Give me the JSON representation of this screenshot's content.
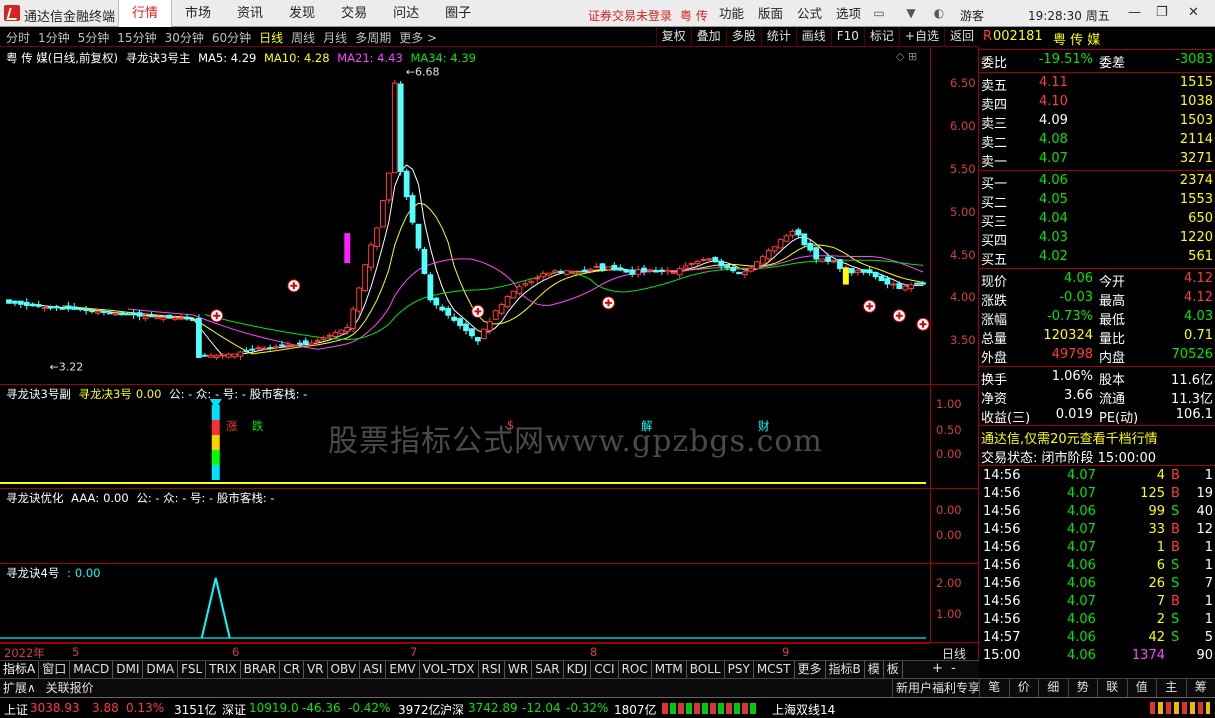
{
  "titlebar": {
    "app_name": "通达信金融终端",
    "menus": [
      "行情",
      "市场",
      "资讯",
      "发现",
      "交易",
      "问达",
      "圈子"
    ],
    "active_menu": "行情",
    "warning": "证券交易未登录",
    "stock_short": "粤 传",
    "right_menus": [
      "功能",
      "版面",
      "公式",
      "选项"
    ],
    "user": "游客",
    "clock": "19:28:30 周五"
  },
  "toolbar": {
    "periods": [
      "分时",
      "1分钟",
      "5分钟",
      "15分钟",
      "30分钟",
      "60分钟",
      "日线",
      "周线",
      "月线",
      "多周期",
      "更多 >"
    ],
    "selected_period": "日线",
    "tools": [
      "复权",
      "叠加",
      "多股",
      "统计",
      "画线",
      "F10",
      "标记",
      "+自选",
      "返回"
    ]
  },
  "main_panel": {
    "title": "粤 传 媒(日线,前复权)",
    "indicator": "寻龙诀3号主",
    "ma5": "MA5: 4.29",
    "ma10": "MA10: 4.28",
    "ma21": "MA21: 4.43",
    "ma34": "MA34: 4.39",
    "high_label": "6.68",
    "low_label": "3.22",
    "y_ticks": [
      "6.50",
      "6.00",
      "5.50",
      "5.00",
      "4.50",
      "4.00",
      "3.50"
    ],
    "events": [
      "涨",
      "跌",
      "$",
      "解",
      "财"
    ]
  },
  "sub1": {
    "name": "寻龙诀3号副",
    "key": "寻龙决3号",
    "val": "0.00",
    "tail": "公: - 众: - 号: - 股市客栈: -",
    "y_ticks": [
      "1.00",
      "0.50",
      "0.00"
    ]
  },
  "sub2": {
    "name": "寻龙诀优化",
    "key": "AAA:",
    "val": "0.00",
    "tail": "公: - 众: - 号: - 股市客栈: -",
    "y_ticks": [
      "0.00",
      "0.00"
    ]
  },
  "sub3": {
    "name": "寻龙诀4号",
    "key": ":",
    "val": "0.00",
    "y_ticks": [
      "2.00",
      "1.00"
    ]
  },
  "watermark": "股票指标公式网www.gpzbgs.com",
  "x_axis": {
    "labels": [
      "2022年",
      "5",
      "6",
      "7",
      "8",
      "9"
    ],
    "period": "日线"
  },
  "chart_data": {
    "type": "candlestick",
    "ma_series": [
      {
        "name": "MA5",
        "color": "#ffffff"
      },
      {
        "name": "MA10",
        "color": "#ffff00"
      },
      {
        "name": "MA21",
        "color": "#ff44ff"
      },
      {
        "name": "MA34",
        "color": "#00e600"
      }
    ],
    "ylim": [
      3.2,
      6.7
    ],
    "high": 6.68,
    "low": 3.22,
    "sub3_peak": 2.0
  },
  "indicator_tabs": [
    "指标A",
    "窗口",
    "MACD",
    "DMI",
    "DMA",
    "FSL",
    "TRIX",
    "BRAR",
    "CR",
    "VR",
    "OBV",
    "ASI",
    "EMV",
    "VOL-TDX",
    "RSI",
    "WR",
    "SAR",
    "KDJ",
    "CCI",
    "ROC",
    "MTM",
    "BOLL",
    "PSY",
    "MCST",
    "更多",
    "指标B",
    "模",
    "板"
  ],
  "ext_bar": {
    "left": [
      "扩展∧",
      "关联报价"
    ],
    "right": "新用户福利专享"
  },
  "status": {
    "sh_name": "上证",
    "sh_val": "3038.93",
    "sh_chg": "3.88",
    "sh_pct": "0.13%",
    "sh_amt": "3151亿",
    "sz_name": "深证",
    "sz_val": "10919.0",
    "sz_chg": "-46.36",
    "sz_pct": "-0.42%",
    "sz_amt": "3972亿",
    "hs_name": "沪深",
    "hs_val": "3742.89",
    "hs_chg": "-12.04",
    "hs_pct": "-0.32%",
    "hs_amt": "1807亿",
    "feed": "上海双线14"
  },
  "quote": {
    "code": "002181",
    "name": "粤 传 媒",
    "flag": "R",
    "wei_bi_label": "委比",
    "wei_bi": "-19.51%",
    "wei_cha_label": "委差",
    "wei_cha": "-3083",
    "asks": [
      {
        "label": "卖五",
        "price": "4.11",
        "vol": "1515"
      },
      {
        "label": "卖四",
        "price": "4.10",
        "vol": "1038"
      },
      {
        "label": "卖三",
        "price": "4.09",
        "vol": "1503"
      },
      {
        "label": "卖二",
        "price": "4.08",
        "vol": "2114"
      },
      {
        "label": "卖一",
        "price": "4.07",
        "vol": "3271"
      }
    ],
    "bids": [
      {
        "label": "买一",
        "price": "4.06",
        "vol": "2374"
      },
      {
        "label": "买二",
        "price": "4.05",
        "vol": "1553"
      },
      {
        "label": "买三",
        "price": "4.04",
        "vol": "650"
      },
      {
        "label": "买四",
        "price": "4.03",
        "vol": "1220"
      },
      {
        "label": "买五",
        "price": "4.02",
        "vol": "561"
      }
    ],
    "stats": [
      [
        "现价",
        "4.06",
        "今开",
        "4.12"
      ],
      [
        "涨跌",
        "-0.03",
        "最高",
        "4.12"
      ],
      [
        "涨幅",
        "-0.73%",
        "最低",
        "4.03"
      ],
      [
        "总量",
        "120324",
        "量比",
        "0.71"
      ],
      [
        "外盘",
        "49798",
        "内盘",
        "70526"
      ]
    ],
    "stats2": [
      [
        "换手",
        "1.06%",
        "股本",
        "11.6亿"
      ],
      [
        "净资",
        "3.66",
        "流通",
        "11.3亿"
      ],
      [
        "收益(三)",
        "0.019",
        "PE(动)",
        "106.1"
      ]
    ],
    "promo": "通达信,仅需20元查看千档行情",
    "trade_state": "交易状态: 闭市阶段 15:00:00",
    "ticks": [
      [
        "14:56",
        "4.07",
        "4",
        "B",
        "1"
      ],
      [
        "14:56",
        "4.07",
        "125",
        "B",
        "19"
      ],
      [
        "14:56",
        "4.06",
        "99",
        "S",
        "40"
      ],
      [
        "14:56",
        "4.07",
        "33",
        "B",
        "12"
      ],
      [
        "14:56",
        "4.07",
        "1",
        "B",
        "1"
      ],
      [
        "14:56",
        "4.06",
        "6",
        "S",
        "1"
      ],
      [
        "14:56",
        "4.06",
        "26",
        "S",
        "7"
      ],
      [
        "14:56",
        "4.07",
        "7",
        "B",
        "1"
      ],
      [
        "14:56",
        "4.06",
        "2",
        "S",
        "1"
      ],
      [
        "14:57",
        "4.06",
        "42",
        "S",
        "5"
      ],
      [
        "15:00",
        "4.06",
        "1374",
        "",
        "90"
      ]
    ]
  },
  "right_tabs": [
    "笔",
    "价",
    "细",
    "势",
    "联",
    "值",
    "主",
    "筹"
  ]
}
